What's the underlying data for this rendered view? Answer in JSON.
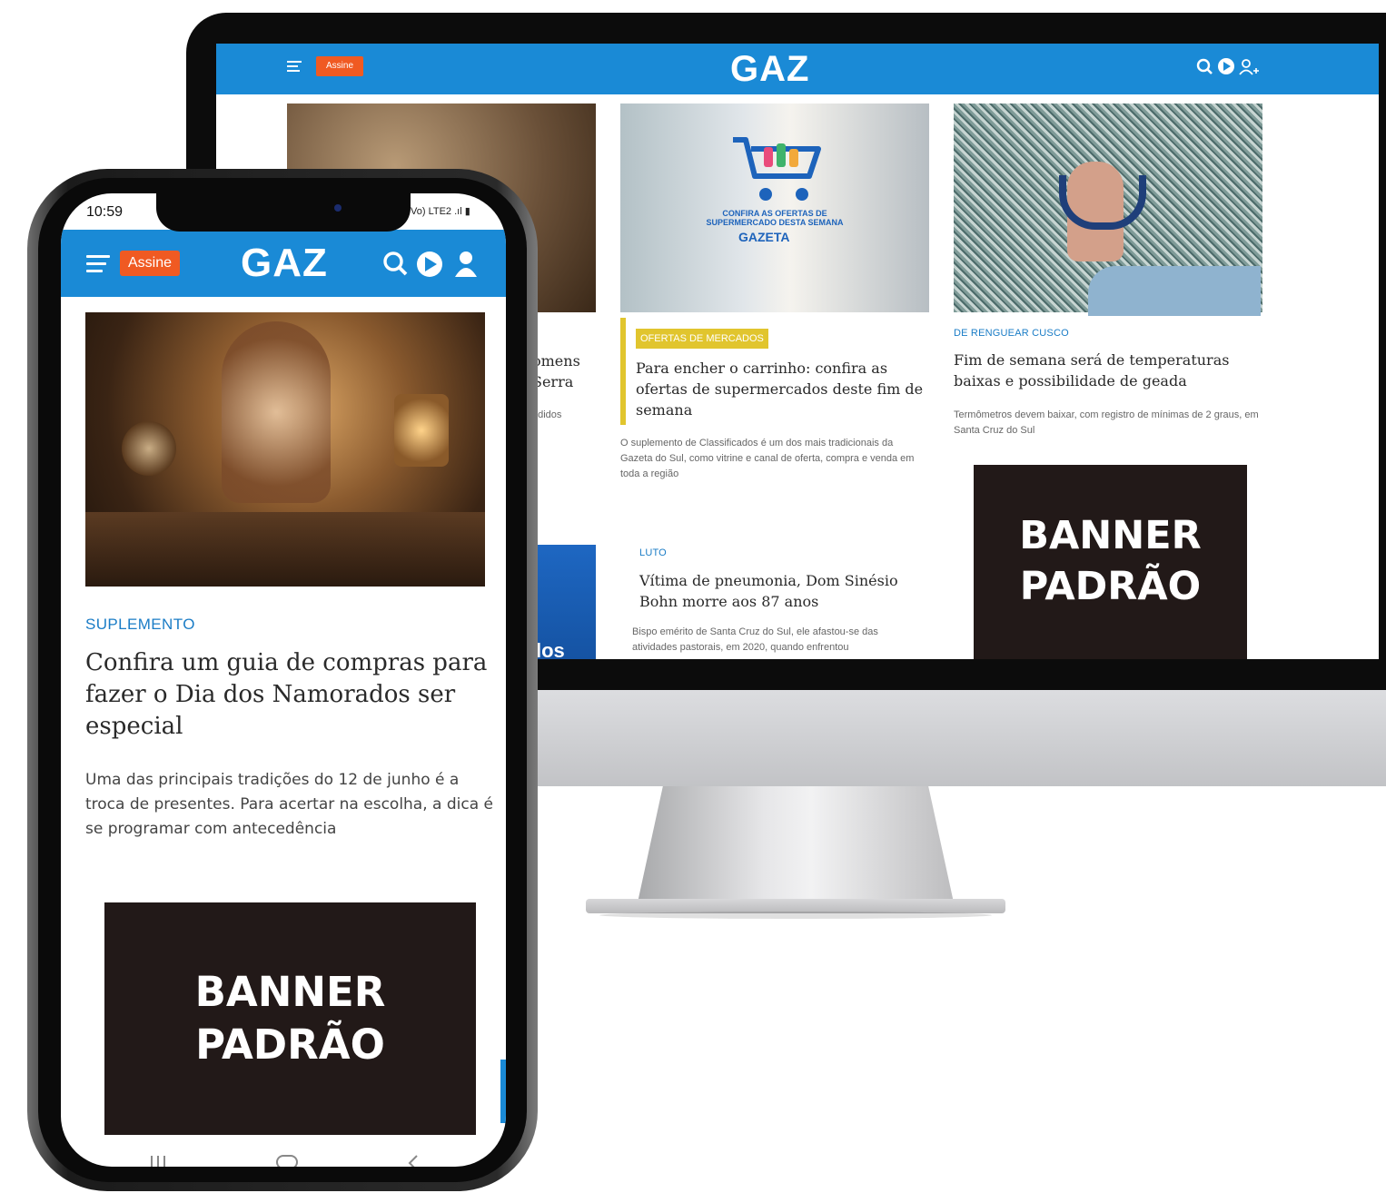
{
  "desktop": {
    "header": {
      "assine_label": "Assine",
      "logo": "GAZ",
      "icons": [
        "search-icon",
        "play-icon",
        "user-add-icon"
      ],
      "brand_color": "#1a8ad6",
      "accent_color": "#f05a22"
    },
    "left_column": {
      "partial_title_line1": "omens",
      "partial_title_line2": "Serra",
      "partial_summary": "ndidos",
      "partial_banner_text": "los"
    },
    "center_card": {
      "image_overlay_title": "CONFIRA AS OFERTAS DE SUPERMERCADO DESTA SEMANA",
      "image_overlay_brand": "GAZETA",
      "category": "OFERTAS DE MERCADOS",
      "title": "Para encher o carrinho: confira as ofertas de supermercados deste fim de semana",
      "summary": "O suplemento de Classificados é um dos mais tradicionais da Gazeta do Sul, como vitrine e canal de oferta, compra e venda em toda a região"
    },
    "center_card_2": {
      "category": "LUTO",
      "title": "Vítima de pneumonia, Dom Sinésio Bohn morre aos 87 anos",
      "summary": "Bispo emérito de Santa Cruz do Sul, ele afastou-se das atividades pastorais, em 2020, quando enfrentou"
    },
    "right_card": {
      "category": "DE RENGUEAR CUSCO",
      "title": "Fim de semana será de temperaturas baixas e possibilidade de geada",
      "summary": "Termômetros devem baixar, com registro de mínimas de 2 graus, em Santa Cruz do Sul"
    },
    "banner": {
      "line1": "BANNER",
      "line2": "PADRÃO"
    }
  },
  "mobile": {
    "status": {
      "time": "10:59",
      "right": "Vo) LTE2 .ıl ▮"
    },
    "header": {
      "assine_label": "Assine",
      "logo": "GAZ",
      "icons": [
        "search-icon",
        "play-icon",
        "user-icon"
      ]
    },
    "article": {
      "category": "SUPLEMENTO",
      "title": "Confira um guia de compras para fazer o Dia dos Namorados ser especial",
      "lead": "Uma das principais tradições do 12 de junho é a troca de presentes. Para acertar na escolha, a dica é se programar com antecedência"
    },
    "banner": {
      "line1": "BANNER",
      "line2": "PADRÃO"
    },
    "nav_icons": [
      "recent-apps-icon",
      "home-icon",
      "back-icon"
    ]
  }
}
